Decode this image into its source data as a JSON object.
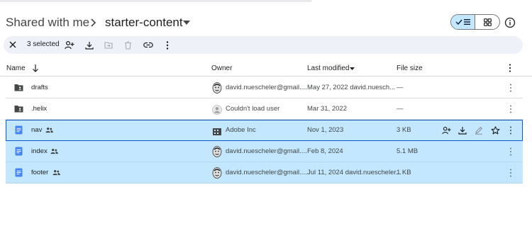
{
  "header": {
    "root_crumb": "Shared with me",
    "current_folder": "starter-content"
  },
  "selection_bar": {
    "count_label": "3 selected"
  },
  "columns": {
    "name": "Name",
    "owner": "Owner",
    "last_modified": "Last modified",
    "file_size": "File size"
  },
  "files": [
    {
      "name": "drafts",
      "type": "shared-folder",
      "owner": "david.nuescheler@gmail....",
      "modified": "May 27, 2022",
      "modified_by": "david.nuesch...",
      "size": "—",
      "selected": false
    },
    {
      "name": ".helix",
      "type": "shared-folder",
      "owner": "Couldn't load user",
      "modified": "Mar 31, 2022",
      "modified_by": "",
      "size": "—",
      "selected": false
    },
    {
      "name": "nav",
      "type": "doc",
      "owner": "Adobe Inc",
      "modified": "Nov 1, 2023",
      "modified_by": "",
      "size": "3 KB",
      "selected": true
    },
    {
      "name": "index",
      "type": "doc",
      "owner": "david.nuescheler@gmail....",
      "modified": "Feb 8, 2024",
      "modified_by": "",
      "size": "5.1 MB",
      "selected": true
    },
    {
      "name": "footer",
      "type": "doc",
      "owner": "david.nuescheler@gmail....",
      "modified": "Jul 11, 2024",
      "modified_by": "david.nuescheler...",
      "size": "1 KB",
      "selected": true
    }
  ],
  "colors": {
    "selected_row": "#c2e7ff",
    "selection_bar": "#eef1f8",
    "doc_icon": "#4285f4",
    "focus_outline": "#0b57d0"
  }
}
